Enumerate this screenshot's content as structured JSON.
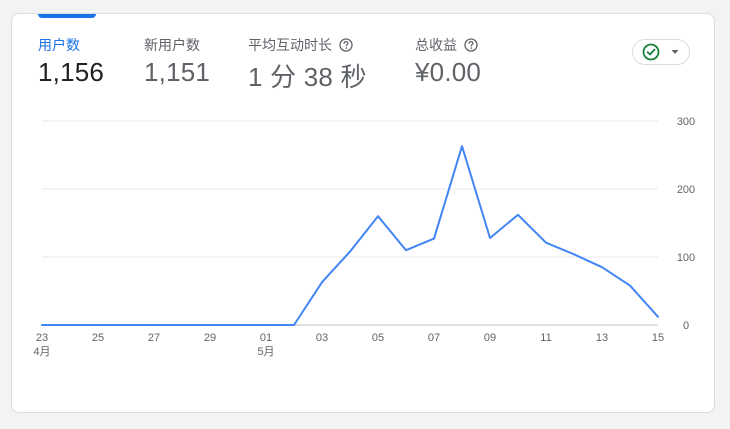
{
  "metrics": [
    {
      "label": "用户数",
      "value": "1,156",
      "has_help": false,
      "active": true
    },
    {
      "label": "新用户数",
      "value": "1,151",
      "has_help": false,
      "active": false
    },
    {
      "label": "平均互动时长",
      "value": "1 分 38 秒",
      "has_help": true,
      "active": false
    },
    {
      "label": "总收益",
      "value": "¥0.00",
      "has_help": true,
      "active": false
    }
  ],
  "status_chip": {
    "icon": "check-circle-icon",
    "dropdown_icon": "caret-down-icon",
    "icon_color": "#188038"
  },
  "colors": {
    "accent": "#1a73e8",
    "line": "#4285f4",
    "grid": "#e8eaed"
  },
  "chart_data": {
    "type": "line",
    "x_tick_labels": [
      "23",
      "25",
      "27",
      "29",
      "01",
      "03",
      "05",
      "07",
      "09",
      "11",
      "13",
      "15"
    ],
    "month_labels": [
      "4月",
      "5月"
    ],
    "y_tick_labels": [
      "300",
      "200",
      "100",
      "0"
    ],
    "ylim": [
      0,
      300
    ],
    "y_axis_position": "right",
    "grid": true,
    "x": [
      "04-23",
      "04-24",
      "04-25",
      "04-26",
      "04-27",
      "04-28",
      "04-29",
      "04-30",
      "05-01",
      "05-02",
      "05-03",
      "05-04",
      "05-05",
      "05-06",
      "05-07",
      "05-08",
      "05-09",
      "05-10",
      "05-11",
      "05-12",
      "05-13",
      "05-14",
      "05-15"
    ],
    "series": [
      {
        "values": [
          0,
          0,
          0,
          0,
          0,
          0,
          0,
          0,
          0,
          0,
          63,
          108,
          160,
          110,
          127,
          263,
          128,
          162,
          121,
          104,
          85,
          58,
          12
        ]
      }
    ]
  }
}
